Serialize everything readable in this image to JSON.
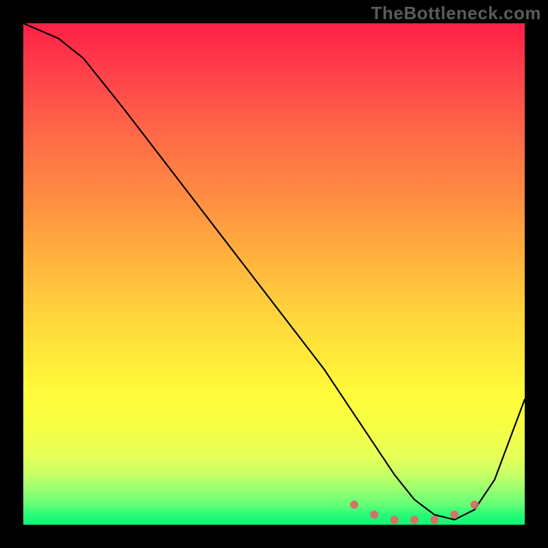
{
  "watermark": "TheBottleneck.com",
  "chart_data": {
    "type": "line",
    "title": "",
    "xlabel": "",
    "ylabel": "",
    "xlim": [
      0,
      100
    ],
    "ylim": [
      0,
      100
    ],
    "series": [
      {
        "name": "bottleneck-curve",
        "x": [
          0,
          7,
          12,
          20,
          30,
          40,
          50,
          60,
          66,
          70,
          74,
          78,
          82,
          86,
          90,
          94,
          100
        ],
        "values": [
          100,
          97,
          93,
          83,
          70,
          57,
          44,
          31,
          22,
          16,
          10,
          5,
          2,
          1,
          3,
          9,
          25
        ]
      }
    ],
    "marker_region": {
      "x": [
        66,
        70,
        74,
        78,
        82,
        86,
        90
      ],
      "values": [
        4,
        2,
        1,
        1,
        1,
        2,
        4
      ]
    },
    "gradient_stops": [
      {
        "pos": 0.0,
        "color": "#ff2047"
      },
      {
        "pos": 0.5,
        "color": "#ffcf3d"
      },
      {
        "pos": 0.8,
        "color": "#fcff3c"
      },
      {
        "pos": 1.0,
        "color": "#0ef774"
      }
    ]
  }
}
